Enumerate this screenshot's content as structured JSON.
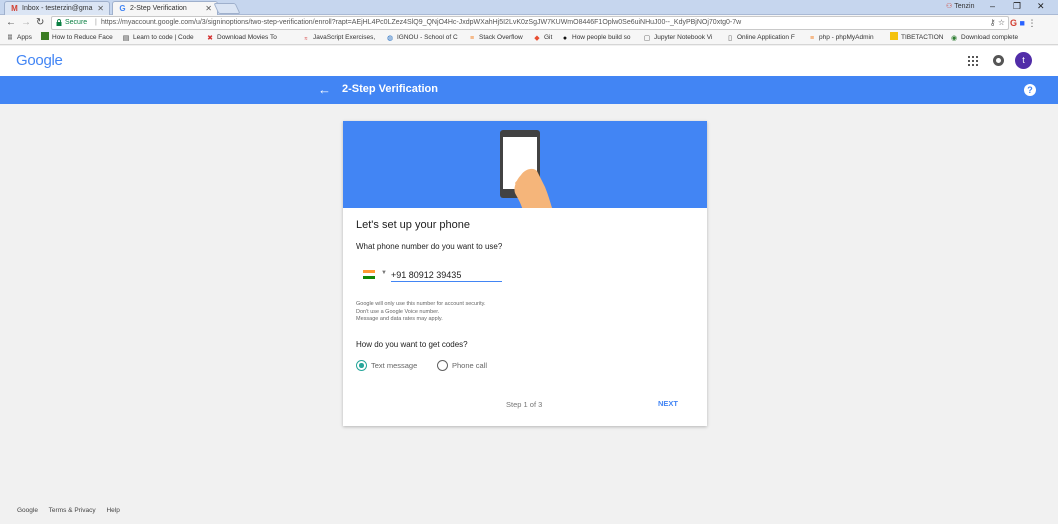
{
  "browser": {
    "tabs": [
      {
        "title": "Inbox - testerzin@gma",
        "active": false,
        "favicon": "gmail-icon"
      },
      {
        "title": "2-Step Verification",
        "active": true,
        "favicon": "google-icon"
      }
    ],
    "profile_name": "Tenzin",
    "secure_label": "Secure",
    "url": "https://myaccount.google.com/u/3/signinoptions/two-step-verification/enroll?rapt=AEjHL4Pc0LZez4SlQ9_QNjO4Hc-JxdpWXahHj5I2LvK0zSgJW7KUWmO8446F1Oplw0Se6uiNHuJ00--_KdyPBjNOj70xtg0-7w",
    "bookmarks": [
      "Apps",
      "How to Reduce Face",
      "Learn to code | Code",
      "Download Movies To",
      "JavaScript Exercises, ",
      "IGNOU - School of C",
      "Stack Overflow",
      "Git",
      "How people build so",
      "Jupyter Notebook Vi",
      "Online Application F",
      "php - phpMyAdmin",
      "TIBETACTION",
      "Download complete"
    ]
  },
  "header": {
    "logo_text": "Google",
    "avatar_letter": "t"
  },
  "bar": {
    "title": "2-Step Verification"
  },
  "card": {
    "title": "Let's set up your phone",
    "phone_question": "What phone number do you want to use?",
    "phone_value": "+91 80912 39435",
    "notes": [
      "Google will only use this number for account security.",
      "Don't use a Google Voice number.",
      "Message and data rates may apply."
    ],
    "codes_question": "How do you want to get codes?",
    "options": [
      {
        "label": "Text message",
        "selected": true
      },
      {
        "label": "Phone call",
        "selected": false
      }
    ],
    "step_text": "Step 1 of 3",
    "next_label": "NEXT"
  },
  "footer": {
    "links": [
      "Google",
      "Terms & Privacy",
      "Help"
    ]
  },
  "colors": {
    "brand_blue": "#4285f4",
    "radio_teal": "#26a69a",
    "avatar_purple": "#512da8",
    "secure_green": "#0b8043"
  }
}
